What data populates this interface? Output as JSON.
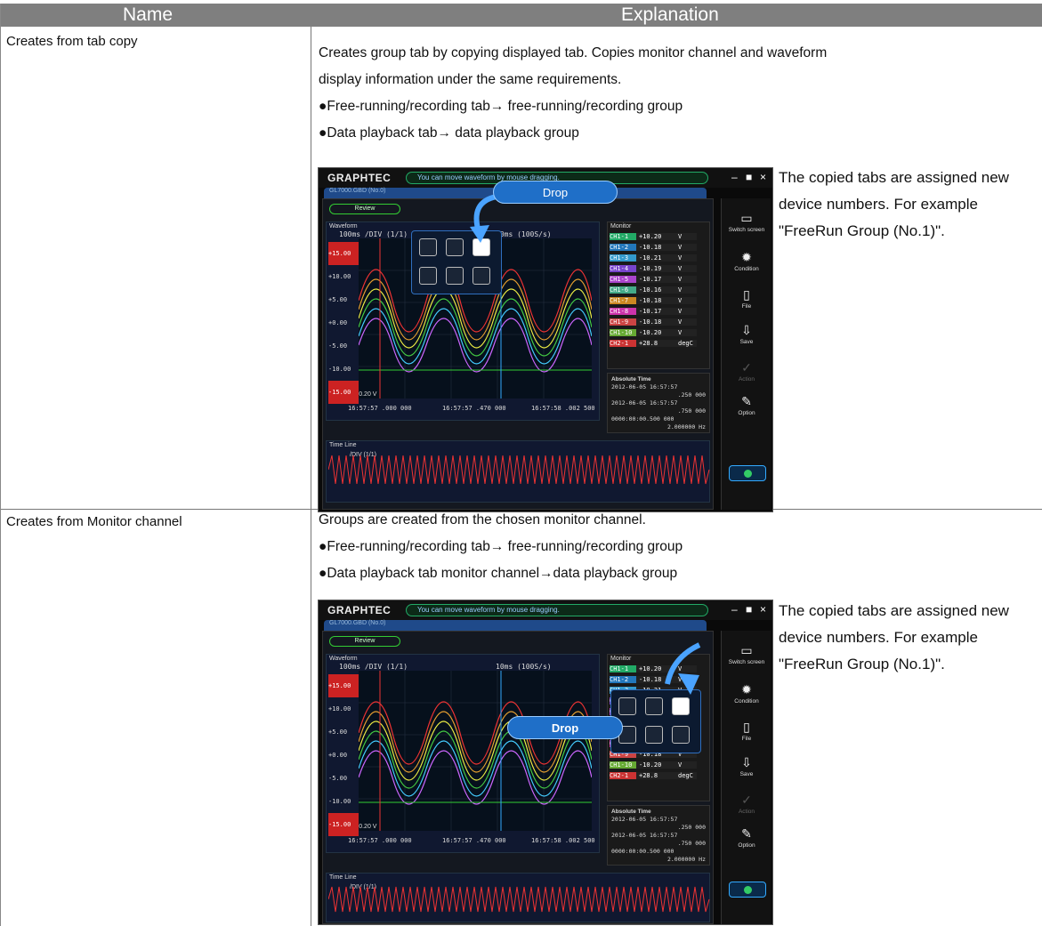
{
  "header": {
    "name": "Name",
    "explanation": "Explanation"
  },
  "rows": [
    {
      "name": "Creates from tab copy",
      "lines": [
        "Creates group tab by copying displayed tab. Copies monitor channel and waveform",
        "display information under the same requirements.",
        "●Free-running/recording tab→ free-running/recording group",
        "●Data playback tab→ data playback group"
      ],
      "note": "The copied tabs are assigned new device numbers. For example \"FreeRun Group (No.1)\".",
      "drop_label": "Drop"
    },
    {
      "name": "Creates from Monitor channel",
      "lines": [
        "Groups are created from the chosen monitor channel.",
        "●Free-running/recording tab→ free-running/recording group",
        "●Data playback tab monitor channel→data playback group"
      ],
      "note": "The copied tabs are assigned new device numbers. For example \"FreeRun Group (No.1)\".",
      "drop_label": "Drop"
    }
  ],
  "app": {
    "logo": "GRAPHTEC",
    "message": "You can move waveform by mouse dragging.",
    "tab": "GL7000.GBD (No.0)",
    "review": "Review",
    "waveform_title": "Waveform",
    "div": "100ms /DIV (1/1)",
    "rate": "10ms (100S/s)",
    "monitor_title": "Monitor",
    "monitor_rows": [
      {
        "ch": "CH1-1",
        "val": "+10.20",
        "unit": "V"
      },
      {
        "ch": "CH1-2",
        "val": "-10.18",
        "unit": "V"
      },
      {
        "ch": "CH1-3",
        "val": "-10.21",
        "unit": "V"
      },
      {
        "ch": "CH1-4",
        "val": "-10.19",
        "unit": "V"
      },
      {
        "ch": "CH1-5",
        "val": "-10.17",
        "unit": "V"
      },
      {
        "ch": "CH1-6",
        "val": "-10.16",
        "unit": "V"
      },
      {
        "ch": "CH1-7",
        "val": "-10.18",
        "unit": "V"
      },
      {
        "ch": "CH1-8",
        "val": "-10.17",
        "unit": "V"
      },
      {
        "ch": "CH1-9",
        "val": "-10.18",
        "unit": "V"
      },
      {
        "ch": "CH1-10",
        "val": "-10.20",
        "unit": "V"
      },
      {
        "ch": "CH2-1",
        "val": "+28.8",
        "unit": "degC"
      }
    ],
    "abs_title": "Absolute Time",
    "abs_lines": [
      "2012-06-05 16:57:57",
      ".250 000",
      "2012-06-05 16:57:57",
      ".750 000",
      "0000:00:00.500 000",
      "2.000000 Hz"
    ],
    "time_labels": [
      "16:57:57 .000 000",
      "16:57:57 .470 000",
      "16:57:58 .002 500"
    ],
    "cursor_value": "-10.20 V",
    "y_labels": [
      "+15.00",
      "+10.00",
      "+5.00",
      "+0.00",
      "-5.00",
      "-10.00",
      "-15.00"
    ],
    "timeline_title": "Time Line",
    "timeline_div": "/DIV (1/1)",
    "side": [
      "Switch screen",
      "Condition",
      "File",
      "Save",
      "Action",
      "Option"
    ]
  }
}
